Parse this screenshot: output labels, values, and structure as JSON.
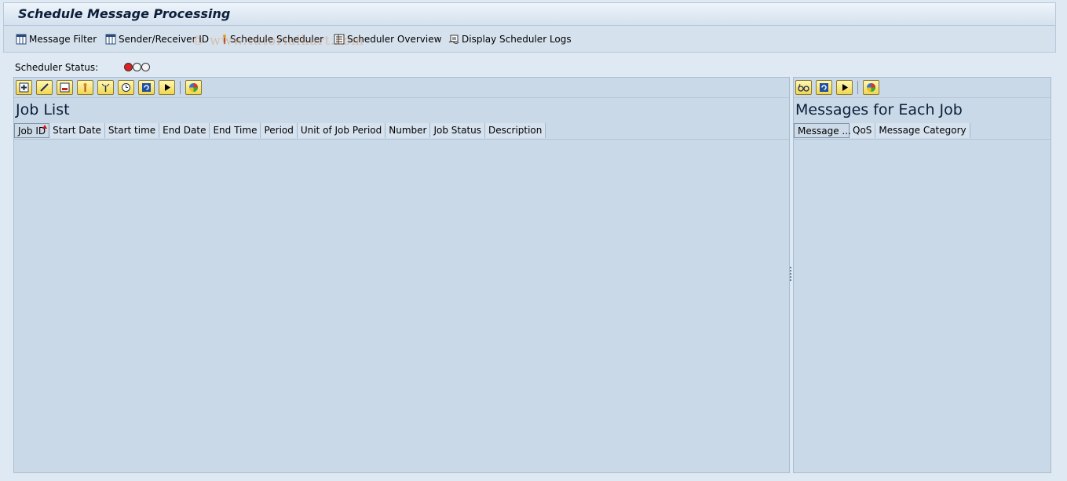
{
  "title": "Schedule Message Processing",
  "app_toolbar": [
    {
      "label": "Message Filter",
      "icon": "grid-filter-icon"
    },
    {
      "label": "Sender/Receiver ID",
      "icon": "grid-id-icon"
    },
    {
      "label": "Schedule Scheduler",
      "icon": "pin-icon"
    },
    {
      "label": "Scheduler Overview",
      "icon": "overview-icon"
    },
    {
      "label": "Display Scheduler Logs",
      "icon": "logs-icon"
    }
  ],
  "watermark": "© www.tutorialkart.com",
  "scheduler_status": {
    "label": "Scheduler Status:",
    "lights": [
      "red",
      "off",
      "off"
    ]
  },
  "job_list": {
    "title": "Job List",
    "toolbar_icons": [
      "create-icon",
      "edit-icon",
      "delete-icon",
      "release-icon",
      "stop-icon",
      "schedule-icon",
      "refresh-icon",
      "execute-icon",
      "statistics-icon"
    ],
    "columns": [
      "Job ID",
      "Start Date",
      "Start time",
      "End Date",
      "End Time",
      "Period",
      "Unit of Job Period",
      "Number",
      "Job Status",
      "Description"
    ],
    "sorted_column": "Job ID"
  },
  "messages": {
    "title": "Messages for Each Job",
    "toolbar_icons": [
      "glasses-icon",
      "refresh-icon",
      "execute-icon",
      "statistics-icon"
    ],
    "columns": [
      "Message ...",
      "QoS",
      "Message Category"
    ]
  }
}
